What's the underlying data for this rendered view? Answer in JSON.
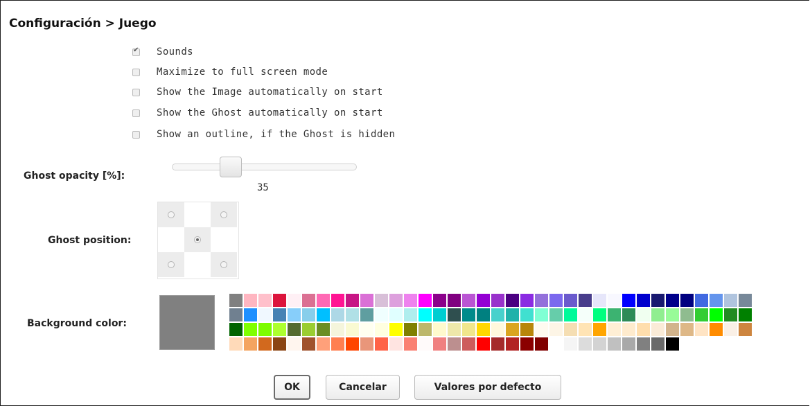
{
  "header": {
    "title": "Configuración > Juego"
  },
  "options": [
    {
      "label": "Sounds",
      "checked": true
    },
    {
      "label": "Maximize to full screen mode",
      "checked": false
    },
    {
      "label": "Show the Image automatically on start",
      "checked": false
    },
    {
      "label": "Show the Ghost automatically on start",
      "checked": false
    },
    {
      "label": "Show an outline, if the Ghost is hidden",
      "checked": false
    }
  ],
  "opacity": {
    "label": "Ghost opacity [%]:",
    "value": "35"
  },
  "position": {
    "label": "Ghost position:",
    "selected": "center"
  },
  "background": {
    "label": "Background color:",
    "selected": "#808080",
    "palette": [
      [
        "#808080",
        "#ffb6c1",
        "#ffc0cb",
        "#dc143c",
        "#fff0f5",
        "#db7093",
        "#ff69b4",
        "#ff1493",
        "#c71585",
        "#da70d6",
        "#d8bfd8",
        "#dda0dd",
        "#ee82ee",
        "#ff00ff",
        "#8b008b",
        "#800080",
        "#ba55d3",
        "#9400d3",
        "#9932cc",
        "#4b0082",
        "#8a2be2",
        "#9370db",
        "#7b68ee",
        "#6a5acd",
        "#483d8b",
        "#e6e6fa",
        "#f8f8ff",
        "#0000ff",
        "#0000cd",
        "#191970",
        "#00008b",
        "#000080",
        "#4169e1",
        "#6495ed",
        "#b0c4de",
        "#778899"
      ],
      [
        "#708090",
        "#1e90ff",
        "#f0f8ff",
        "#4682b4",
        "#87cefa",
        "#87ceeb",
        "#00bfff",
        "#add8e6",
        "#b0e0e6",
        "#5f9ea0",
        "#f0ffff",
        "#e0ffff",
        "#afeeee",
        "#00ffff",
        "#00ced1",
        "#2f4f4f",
        "#008b8b",
        "#008080",
        "#48d1cc",
        "#20b2aa",
        "#40e0d0",
        "#7fffd4",
        "#66cdaa",
        "#00fa9a",
        "#f5fffa",
        "#00ff7f",
        "#3cb371",
        "#2e8b57",
        "#f0fff0",
        "#90ee90",
        "#98fb98",
        "#8fbc8f",
        "#32cd32",
        "#00ff00",
        "#228b22",
        "#008000"
      ],
      [
        "#006400",
        "#7fff00",
        "#7cfc00",
        "#adff2f",
        "#556b2f",
        "#9acd32",
        "#6b8e23",
        "#f5f5dc",
        "#fafad2",
        "#fffff0",
        "#ffffe0",
        "#ffff00",
        "#808000",
        "#bdb76b",
        "#fffacd",
        "#eee8aa",
        "#f0e68c",
        "#ffd700",
        "#fff8dc",
        "#daa520",
        "#b8860b",
        "#fffaf0",
        "#fdf5e6",
        "#f5deb3",
        "#ffe4b5",
        "#ffa500",
        "#ffefd5",
        "#ffebcd",
        "#ffdead",
        "#faebd7",
        "#d2b48c",
        "#deb887",
        "#ffe4c4",
        "#ff8c00",
        "#faf0e6",
        "#cd853f"
      ],
      [
        "#ffdab9",
        "#f4a460",
        "#d2691e",
        "#8b4513",
        "#fff5ee",
        "#a0522d",
        "#ffa07a",
        "#ff7f50",
        "#ff4500",
        "#e9967a",
        "#ff6347",
        "#ffe4e1",
        "#fa8072",
        "#fffafa",
        "#f08080",
        "#bc8f8f",
        "#cd5c5c",
        "#ff0000",
        "#a52a2a",
        "#b22222",
        "#8b0000",
        "#800000",
        "#ffffff",
        "#f5f5f5",
        "#dcdcdc",
        "#d3d3d3",
        "#c0c0c0",
        "#a9a9a9",
        "#808080",
        "#696969",
        "#000000"
      ]
    ]
  },
  "buttons": {
    "ok": "OK",
    "cancel": "Cancelar",
    "defaults": "Valores por defecto"
  }
}
